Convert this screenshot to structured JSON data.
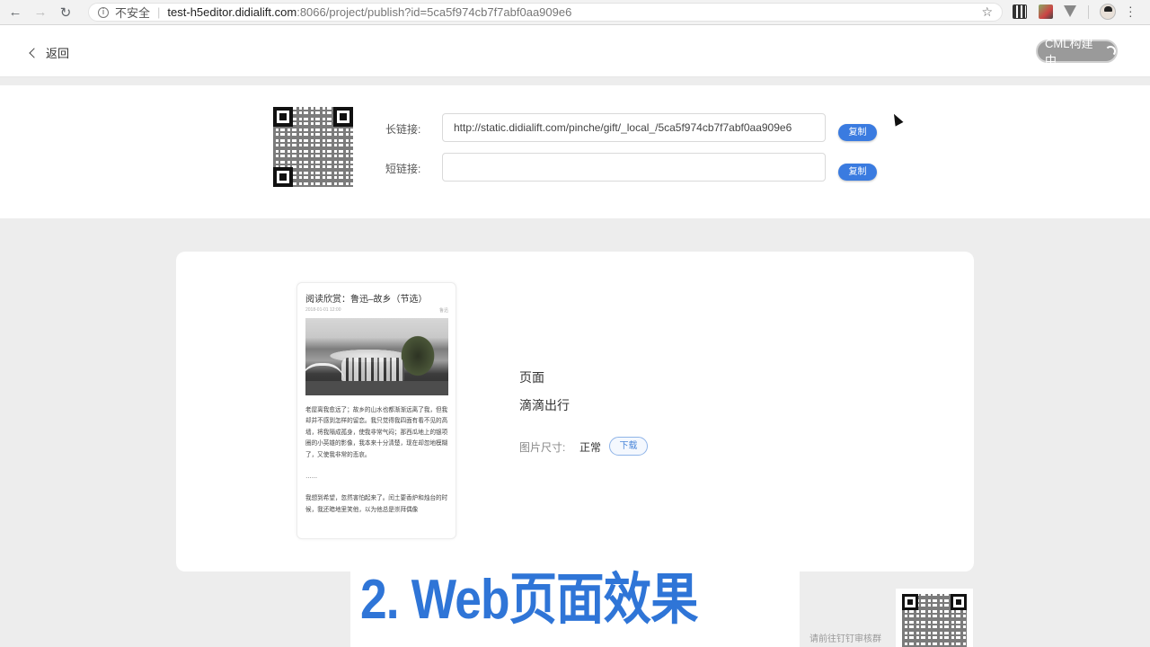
{
  "browser": {
    "security_label": "不安全",
    "url_host": "test-h5editor.didialift.com",
    "url_rest": ":8066/project/publish?id=5ca5f974cb7f7abf0aa909e6"
  },
  "header": {
    "back_label": "返回",
    "build_label": "CML构建中"
  },
  "links": {
    "long_label": "长链接:",
    "long_value": "http://static.didialift.com/pinche/gift/_local_/5ca5f974cb7f7abf0aa909e6",
    "short_label": "短链接:",
    "short_value": "",
    "copy_label": "复制"
  },
  "preview": {
    "title": "阅读欣赏：鲁迅–故乡（节选）",
    "date": "2018-01-01 12:00",
    "author": "鲁迅",
    "paragraphs": [
      "老屋离我愈远了；故乡的山水也都渐渐远离了我，但我却并不感到怎样的留恋。我只觉得我四面有看不见的高墙，将我隔成孤身，使我非常气闷；那西瓜地上的银项圈的小英雄的影像，我本来十分清楚，现在却忽地模糊了，又使我非常的悲哀。",
      "……",
      "我想到希望，忽然害怕起来了。闰土要香炉和烛台的时候，我还暗地里笑他，以为他总是崇拜偶像"
    ]
  },
  "info": {
    "type_label": "页面",
    "name": "滴滴出行",
    "size_label": "图片尺寸:",
    "size_value": "正常",
    "download_label": "下载"
  },
  "overlay": {
    "caption": "2. Web页面效果"
  },
  "footer": {
    "review_note": "请前往钉钉审核群"
  },
  "colors": {
    "primary": "#3a7be0",
    "caption": "#2f75d7",
    "build_button": "#9a9a9a"
  }
}
